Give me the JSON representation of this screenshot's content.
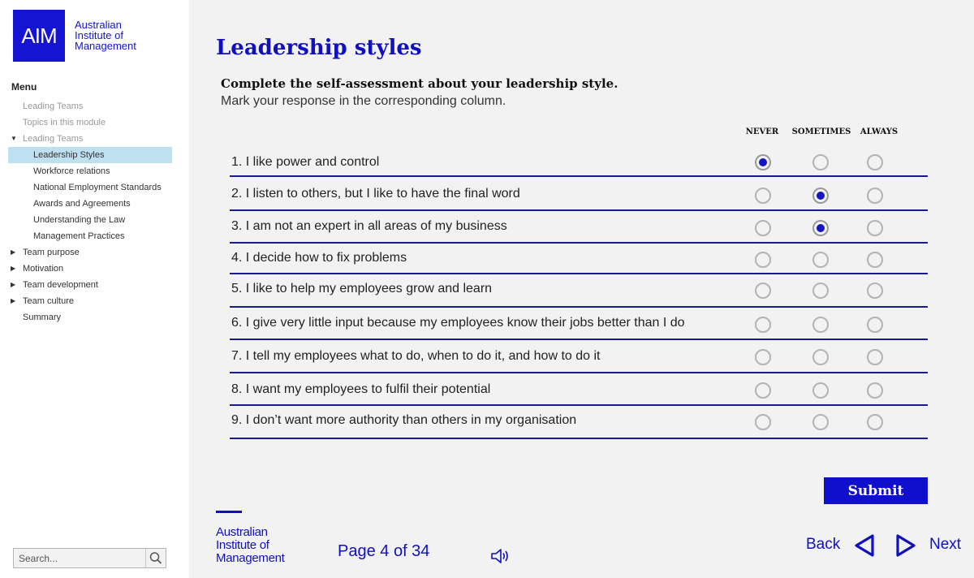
{
  "brand": {
    "logo_mark": "AIM",
    "name_line1": "Australian",
    "name_line2": "Institute of",
    "name_line3": "Management",
    "color": "#1414d2"
  },
  "sidebar": {
    "menu_title": "Menu",
    "items": [
      {
        "label": "Leading Teams",
        "level": 0,
        "dim": true,
        "caret": ""
      },
      {
        "label": "Topics in this module",
        "level": 0,
        "dim": true,
        "caret": ""
      },
      {
        "label": "Leading Teams",
        "level": 0,
        "dim": true,
        "caret": "down"
      },
      {
        "label": "Leadership Styles",
        "level": 1,
        "selected": true
      },
      {
        "label": "Workforce relations",
        "level": 1
      },
      {
        "label": "National Employment Standards",
        "level": 1
      },
      {
        "label": "Awards and Agreements",
        "level": 1
      },
      {
        "label": "Understanding the Law",
        "level": 1
      },
      {
        "label": "Management Practices",
        "level": 1
      },
      {
        "label": "Team purpose",
        "level": 0,
        "caret": "right"
      },
      {
        "label": "Motivation",
        "level": 0,
        "caret": "right"
      },
      {
        "label": "Team development",
        "level": 0,
        "caret": "right"
      },
      {
        "label": "Team culture",
        "level": 0,
        "caret": "right"
      },
      {
        "label": "Summary",
        "level": 0,
        "caret": ""
      }
    ],
    "search": {
      "placeholder": "Search...",
      "icon": "search-icon"
    }
  },
  "main": {
    "title": "Leadership styles",
    "instruction_bold": "Complete the self-assessment about your leadership style.",
    "instruction": "Mark your response in the corresponding column.",
    "columns": [
      "NEVER",
      "SOMETIMES",
      "ALWAYS"
    ],
    "questions": [
      {
        "text": "1. I like power and control",
        "selected": 0
      },
      {
        "text": "2. I listen to others, but I like to have the final word",
        "selected": 1
      },
      {
        "text": "3. I am not an expert in all areas of my business",
        "selected": 1
      },
      {
        "text": "4. I decide how to fix problems",
        "selected": -1
      },
      {
        "text": "5. I like to help my employees grow and learn",
        "selected": -1
      },
      {
        "text": "6. I give very little input because my employees know their jobs better than I do",
        "selected": -1
      },
      {
        "text": "7. I tell my employees what to do, when to do it, and how to do it",
        "selected": -1
      },
      {
        "text": "8. I want my employees to fulfil their potential",
        "selected": -1
      },
      {
        "text": "9. I don’t want more authority than others in my organisation",
        "selected": -1
      }
    ],
    "submit_label": "Submit"
  },
  "footer": {
    "logo_line1": "Australian",
    "logo_line2": "Institute of",
    "logo_line3": "Management",
    "page_indicator": "Page 4 of 34",
    "audio_icon": "speaker-icon",
    "back_label": "Back",
    "next_label": "Next"
  }
}
